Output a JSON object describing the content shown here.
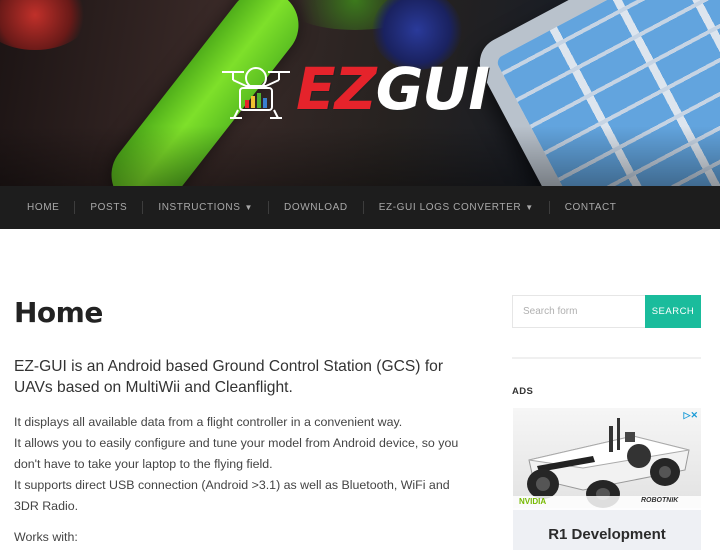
{
  "site": {
    "logo_text_ez": "EZ",
    "logo_text_gui": "GUI",
    "colors": {
      "accent": "#1abc9c",
      "nav_bg": "#1d1d1d",
      "logo_red": "#e5232b"
    }
  },
  "nav": {
    "items": [
      {
        "label": "HOME",
        "has_dropdown": false
      },
      {
        "label": "POSTS",
        "has_dropdown": false
      },
      {
        "label": "INSTRUCTIONS",
        "has_dropdown": true
      },
      {
        "label": "DOWNLOAD",
        "has_dropdown": false
      },
      {
        "label": "EZ-GUI LOGS CONVERTER",
        "has_dropdown": true
      },
      {
        "label": "CONTACT",
        "has_dropdown": false
      }
    ]
  },
  "main": {
    "title": "Home",
    "lead": "EZ-GUI is an Android based Ground Control Station (GCS) for UAVs based on MultiWii and Cleanflight.",
    "paragraphs": [
      "It displays all available data from a flight controller in a convenient way.",
      "It allows you to easily configure and tune your model from Android device, so you don't have to take your laptop to the flying field.",
      "It supports direct USB connection (Android >3.1) as well as Bluetooth, WiFi and 3DR Radio."
    ],
    "works_with": "Works with:"
  },
  "sidebar": {
    "search": {
      "placeholder": "Search form",
      "button": "SEARCH"
    },
    "ads_title": "ADS",
    "ad": {
      "title": "R1 Development",
      "brand_left": "NVIDIA",
      "brand_right": "ROBOTNIK",
      "badge": "▷✕"
    }
  }
}
